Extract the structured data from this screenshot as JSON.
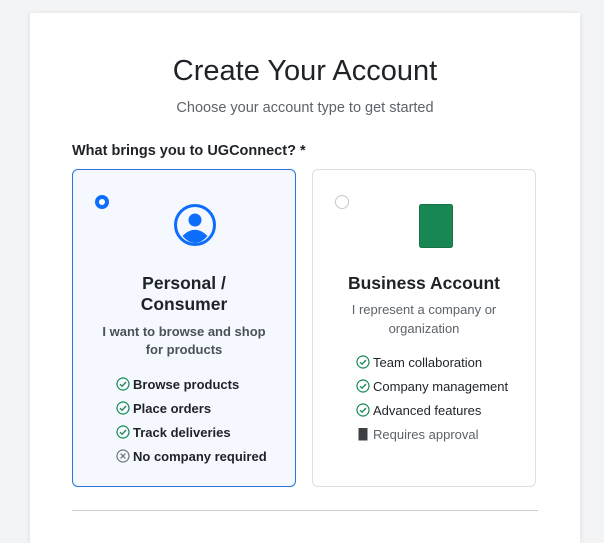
{
  "header": {
    "title": "Create Your Account",
    "subtitle": "Choose your account type to get started"
  },
  "form": {
    "question": "What brings you to UGConnect? *"
  },
  "options": {
    "personal": {
      "selected": true,
      "title_line1": "Personal /",
      "title_line2": "Consumer",
      "desc_line1": "I want to browse and shop",
      "desc_line2": "for products",
      "features": [
        {
          "label": "Browse products",
          "icon": "check-circle-icon"
        },
        {
          "label": "Place orders",
          "icon": "check-circle-icon"
        },
        {
          "label": "Track deliveries",
          "icon": "check-circle-icon"
        },
        {
          "label": "No company required",
          "icon": "x-circle-icon"
        }
      ]
    },
    "business": {
      "selected": false,
      "title": "Business Account",
      "desc_line1": "I represent a company or",
      "desc_line2": "organization",
      "features": [
        {
          "label": "Team collaboration",
          "icon": "check-circle-icon"
        },
        {
          "label": "Company management",
          "icon": "check-circle-icon"
        },
        {
          "label": "Advanced features",
          "icon": "check-circle-icon"
        },
        {
          "label": "Requires approval",
          "icon": "hourglass-icon"
        }
      ]
    }
  },
  "colors": {
    "accent": "#0d6efd",
    "success": "#198754",
    "business_icon": "#198754",
    "selected_bg": "#f5f8fe"
  }
}
